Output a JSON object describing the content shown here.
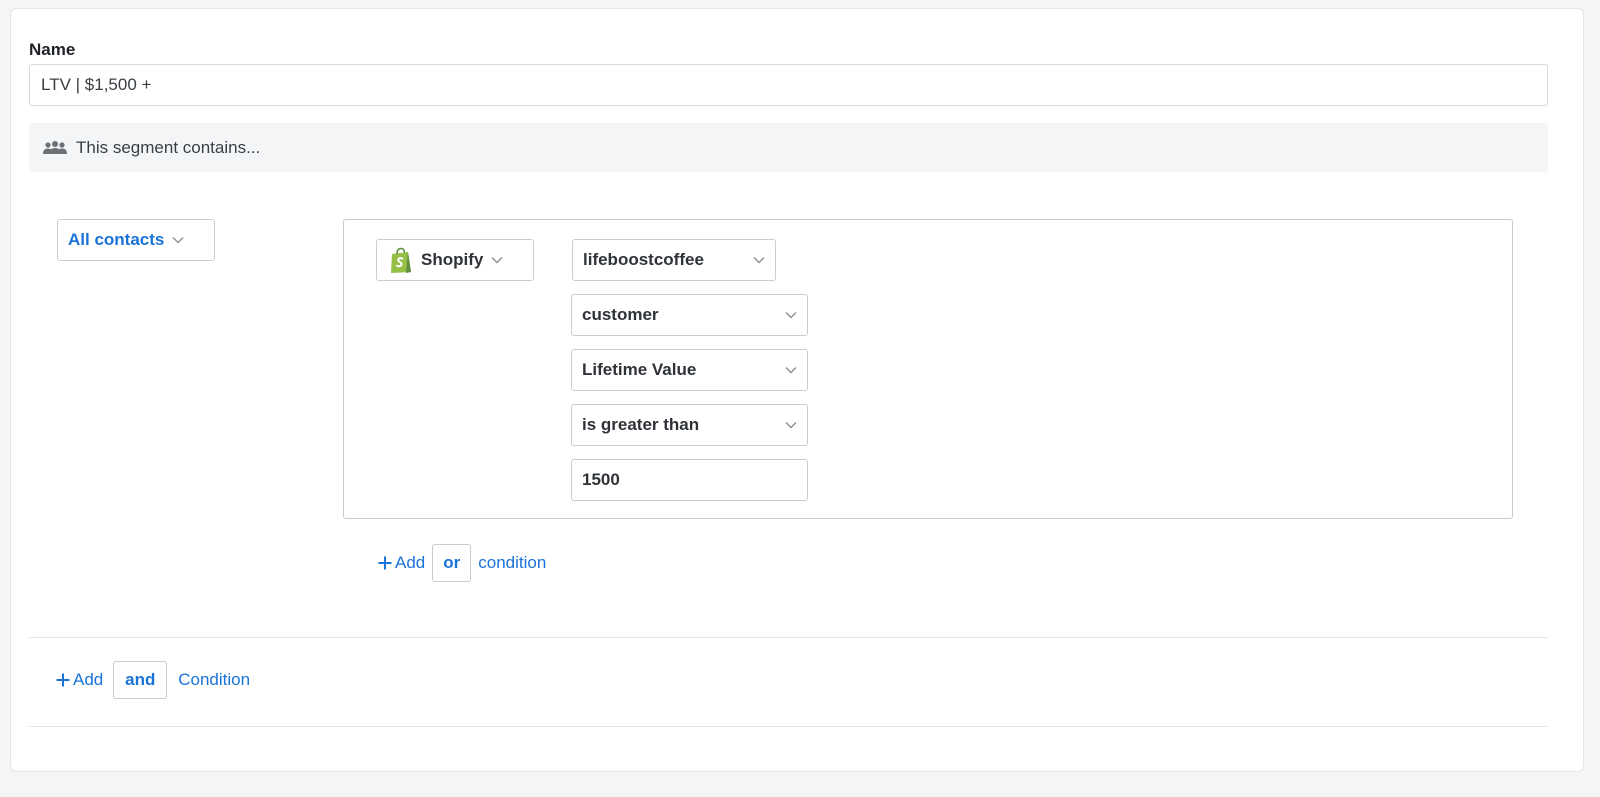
{
  "form": {
    "name_label": "Name",
    "name_value": "LTV | $1,500 +"
  },
  "segment": {
    "icon": "users-icon",
    "text": "This segment contains..."
  },
  "scope": {
    "selected": "All contacts"
  },
  "condition": {
    "integration": "Shopify",
    "integration_icon": "shopify-bag-icon",
    "store": "lifeboostcoffee",
    "object": "customer",
    "field": "Lifetime Value",
    "operator": "is greater than",
    "value": "1500"
  },
  "or_action": {
    "add_label": "Add",
    "operator": "or",
    "suffix": "condition"
  },
  "and_action": {
    "add_label": "Add",
    "operator": "and",
    "suffix": "Condition"
  },
  "colors": {
    "accent": "#1a73d9",
    "shopify_green": "#95bf47",
    "border": "#c9cdd2",
    "panel_bg": "#f4f5f7"
  }
}
